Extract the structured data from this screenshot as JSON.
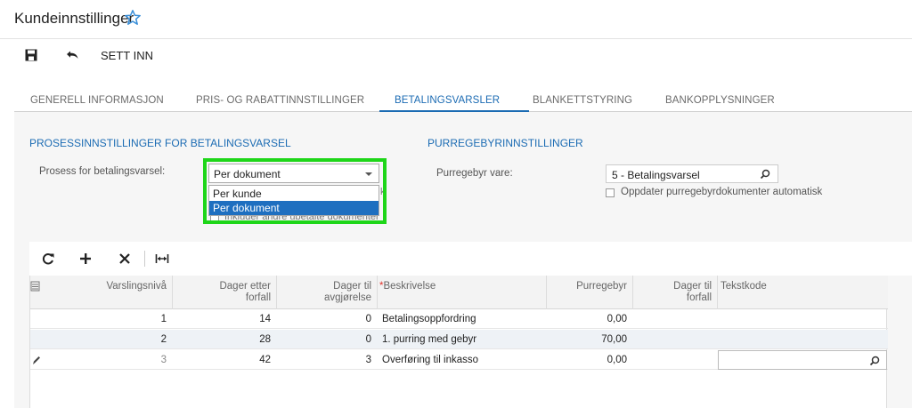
{
  "page": {
    "title": "Kundeinnstillinger"
  },
  "toolbar": {
    "insert_label": "SETT INN"
  },
  "tabs": [
    {
      "label": "GENERELL INFORMASJON"
    },
    {
      "label": "PRIS- OG RABATTINNSTILLINGER"
    },
    {
      "label": "BETALINGSVARSLER"
    },
    {
      "label": "BLANKETTSTYRING"
    },
    {
      "label": "BANKOPPLYSNINGER"
    }
  ],
  "process": {
    "section_title": "PROSESSINNSTILLINGER FOR BETALINGSVARSEL",
    "field_label": "Prosess for betalingsvarsel:",
    "selected_value": "Per dokument",
    "options": [
      "Per kunde",
      "Per dokument"
    ],
    "hidden_option_text": "Inkluder andre ubetalte dokumenter",
    "hidden_suffix": "k"
  },
  "fee": {
    "section_title": "PURREGEBYRINNSTILLINGER",
    "field_label": "Purregebyr vare:",
    "value": "5 - Betalingsvarsel",
    "checkbox_label": "Oppdater purregebyrdokumenter automatisk"
  },
  "grid": {
    "headers": {
      "level": "Varslingsnivå",
      "days_due_1": "Dager etter",
      "days_due_2": "forfall",
      "days_settle_1": "Dager til",
      "days_settle_2": "avgjørelse",
      "req_mark": "*",
      "description": "Beskrivelse",
      "fee": "Purregebyr",
      "days_to_due_1": "Dager til",
      "days_to_due_2": "forfall",
      "text_code": "Tekstkode"
    },
    "rows": [
      {
        "level": "1",
        "days_after": "14",
        "days_settle": "0",
        "description": "Betalingsoppfordring",
        "fee": "0,00"
      },
      {
        "level": "2",
        "days_after": "28",
        "days_settle": "0",
        "description": "1. purring med gebyr",
        "fee": "70,00"
      },
      {
        "level": "3",
        "days_after": "42",
        "days_settle": "3",
        "description": "Overføring til inkasso",
        "fee": "0,00"
      }
    ]
  },
  "colors": {
    "accent": "#1b6bb3",
    "highlight": "#1ed619"
  }
}
